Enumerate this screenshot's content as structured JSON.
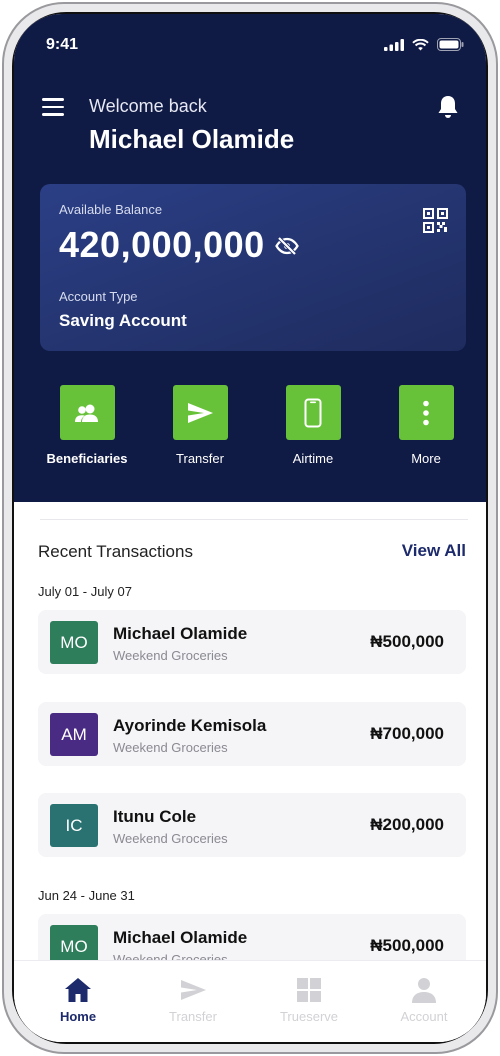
{
  "status_bar": {
    "time": "9:41"
  },
  "header": {
    "welcome": "Welcome back",
    "user_name": "Michael Olamide"
  },
  "balance_card": {
    "balance_label": "Available Balance",
    "balance_value": "420,000,000",
    "account_type_label": "Account Type",
    "account_type_value": "Saving Account"
  },
  "actions": [
    {
      "label": "Beneficiaries",
      "icon": "people-icon"
    },
    {
      "label": "Transfer",
      "icon": "send-icon"
    },
    {
      "label": "Airtime",
      "icon": "phone-icon"
    },
    {
      "label": "More",
      "icon": "more-vertical-icon"
    }
  ],
  "transactions_section": {
    "title": "Recent Transactions",
    "view_all": "View All",
    "groups": [
      {
        "date": "July 01 - July 07",
        "items": [
          {
            "initials": "MO",
            "name": "Michael Olamide",
            "desc": "Weekend Groceries",
            "amount": "₦500,000",
            "color": "#2e7d5b"
          },
          {
            "initials": "AM",
            "name": "Ayorinde Kemisola",
            "desc": "Weekend Groceries",
            "amount": "₦700,000",
            "color": "#4a2b83"
          },
          {
            "initials": "IC",
            "name": "Itunu Cole",
            "desc": "Weekend Groceries",
            "amount": "₦200,000",
            "color": "#2a7272"
          }
        ]
      },
      {
        "date": "Jun 24 - June 31",
        "items": [
          {
            "initials": "MO",
            "name": "Michael Olamide",
            "desc": "Weekend Groceries",
            "amount": "₦500,000",
            "color": "#2e7d5b"
          }
        ]
      }
    ]
  },
  "bottom_nav": [
    {
      "label": "Home",
      "icon": "home-icon",
      "active": true
    },
    {
      "label": "Transfer",
      "icon": "send-icon",
      "active": false
    },
    {
      "label": "Trueserve",
      "icon": "grid-icon",
      "active": false
    },
    {
      "label": "Account",
      "icon": "user-icon",
      "active": false
    }
  ],
  "colors": {
    "primary_dark": "#0f1a45",
    "accent_green": "#67c23a",
    "link_blue": "#1d2a6b"
  }
}
